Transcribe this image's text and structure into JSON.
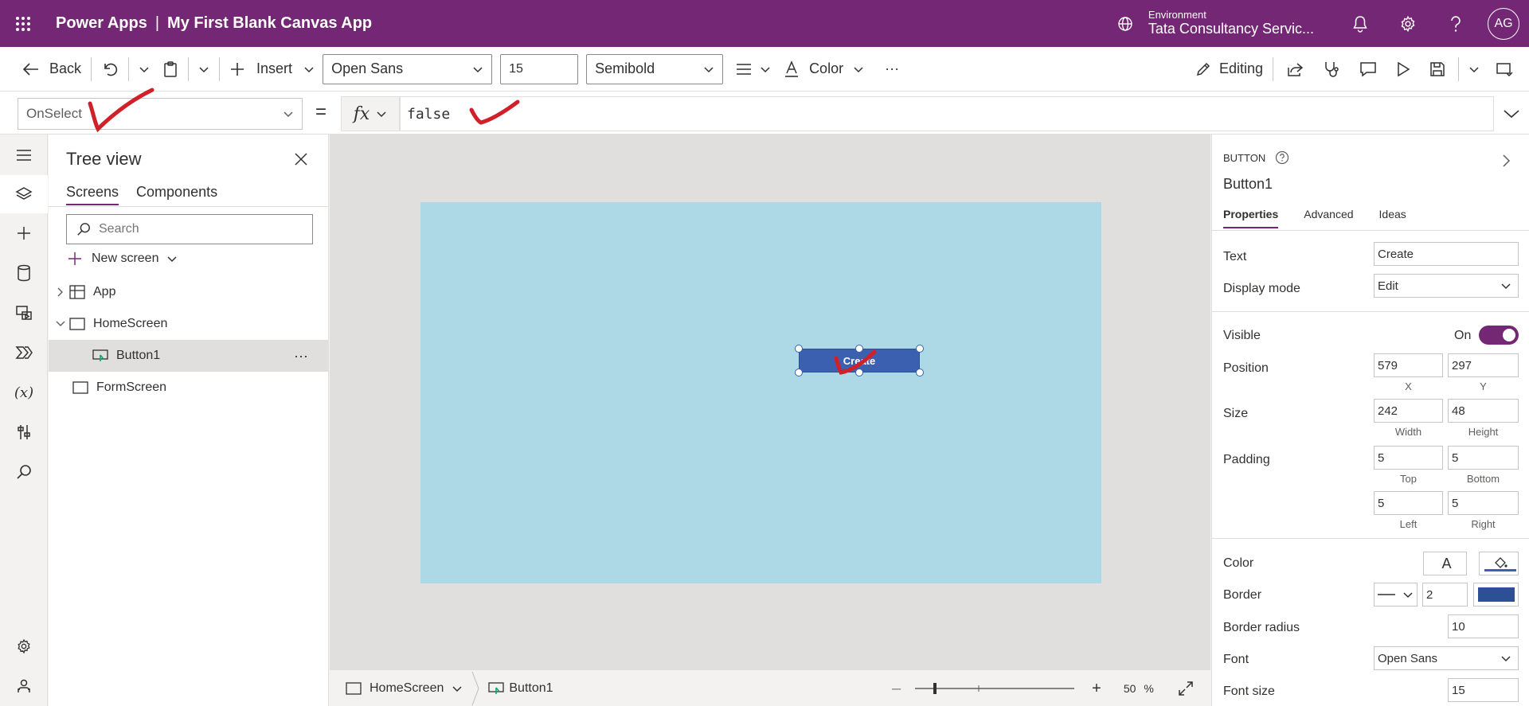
{
  "header": {
    "product": "Power Apps",
    "separator": "|",
    "app_name": "My First Blank Canvas App",
    "environment_label": "Environment",
    "environment_value": "Tata Consultancy Servic...",
    "avatar_initials": "AG"
  },
  "cmdbar": {
    "back_label": "Back",
    "insert_label": "Insert",
    "font_family": "Open Sans",
    "font_size": "15",
    "font_weight": "Semibold",
    "color_label": "Color",
    "more_label": "···",
    "editing_label": "Editing"
  },
  "formula": {
    "property": "OnSelect",
    "equals": "=",
    "fx": "fx",
    "expression": "false"
  },
  "tree": {
    "title": "Tree view",
    "tabs": [
      "Screens",
      "Components"
    ],
    "search_placeholder": "Search",
    "new_screen_label": "New screen",
    "nodes": {
      "app": "App",
      "home": "HomeScreen",
      "button": "Button1",
      "form": "FormScreen"
    },
    "more": "···"
  },
  "canvas": {
    "button_text": "Create"
  },
  "bottombar": {
    "screen": "HomeScreen",
    "control": "Button1",
    "zoom_value": "50",
    "zoom_unit": "%",
    "zoom_percent": 50
  },
  "props": {
    "type_label": "BUTTON",
    "control_name": "Button1",
    "tabs": [
      "Properties",
      "Advanced",
      "Ideas"
    ],
    "text_label": "Text",
    "text_value": "Create",
    "display_mode_label": "Display mode",
    "display_mode_value": "Edit",
    "visible_label": "Visible",
    "visible_state": "On",
    "position_label": "Position",
    "position_x": "579",
    "position_y": "297",
    "x_label": "X",
    "y_label": "Y",
    "size_label": "Size",
    "size_w": "242",
    "size_h": "48",
    "width_label": "Width",
    "height_label": "Height",
    "padding_label": "Padding",
    "pad_top": "5",
    "pad_bottom": "5",
    "pad_left": "5",
    "pad_right": "5",
    "top_label": "Top",
    "bottom_label": "Bottom",
    "left_label": "Left",
    "right_label": "Right",
    "color_label": "Color",
    "color_text_glyph": "A",
    "border_label": "Border",
    "border_width": "2",
    "border_radius_label": "Border radius",
    "border_radius_value": "10",
    "font_label": "Font",
    "font_value": "Open Sans",
    "font_size_label": "Font size",
    "font_size_value": "15"
  },
  "colors": {
    "brand": "#742774",
    "canvas_fill": "#add8e6",
    "button_fill": "#3b60b0",
    "annotation": "#d0202a"
  }
}
